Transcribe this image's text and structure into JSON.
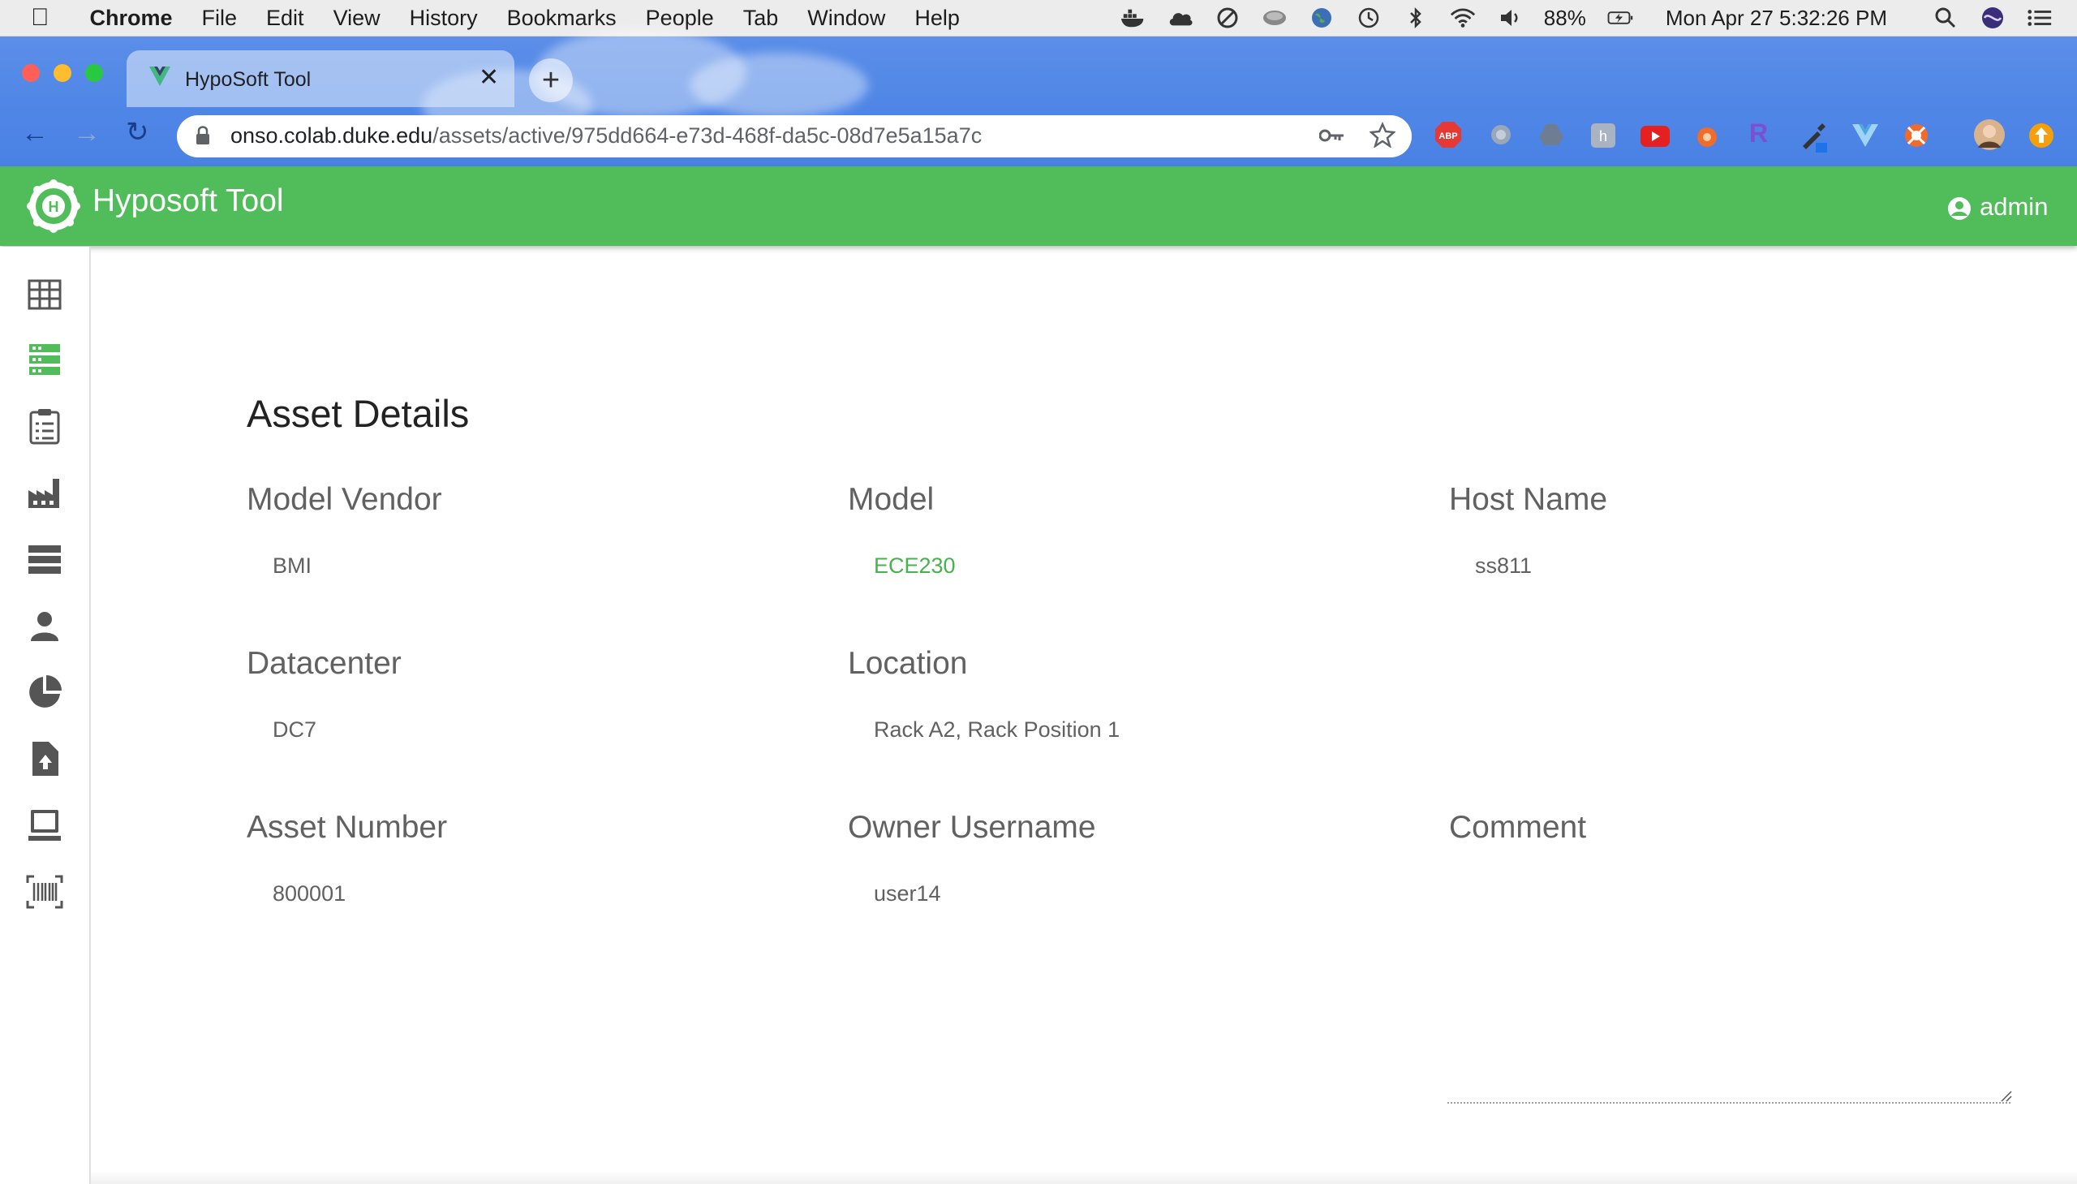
{
  "menubar": {
    "app": "Chrome",
    "items": [
      "File",
      "Edit",
      "View",
      "History",
      "Bookmarks",
      "People",
      "Tab",
      "Window",
      "Help"
    ],
    "battery": "88%",
    "datetime": "Mon Apr 27  5:32:26 PM"
  },
  "browser": {
    "tab_title": "HypoSoft Tool",
    "url_host": "onso.colab.duke.edu",
    "url_path": "/assets/active/975dd664-e73d-468f-da5c-08d7e5a15a7c",
    "extension_labels": {
      "abp": "ABP",
      "r": "R"
    }
  },
  "app": {
    "title": "Hyposoft Tool",
    "user": "admin",
    "nav": [
      "table-icon",
      "assets-icon",
      "clipboard-list-icon",
      "factory-icon",
      "rack-icon",
      "person-icon",
      "pie-chart-icon",
      "file-upload-icon",
      "laptop-icon",
      "barcode-icon"
    ]
  },
  "asset": {
    "heading": "Asset Details",
    "model_vendor_label": "Model Vendor",
    "model_vendor": "BMI",
    "model_label": "Model",
    "model": "ECE230",
    "host_name_label": "Host Name",
    "host_name": "ss811",
    "datacenter_label": "Datacenter",
    "datacenter": "DC7",
    "location_label": "Location",
    "location": "Rack A2, Rack Position 1",
    "asset_number_label": "Asset Number",
    "asset_number": "800001",
    "owner_label": "Owner Username",
    "owner": "user14",
    "comment_label": "Comment",
    "comment": ""
  },
  "colors": {
    "accent": "#51bd5a",
    "link": "#4caf50",
    "text": "#616161"
  }
}
